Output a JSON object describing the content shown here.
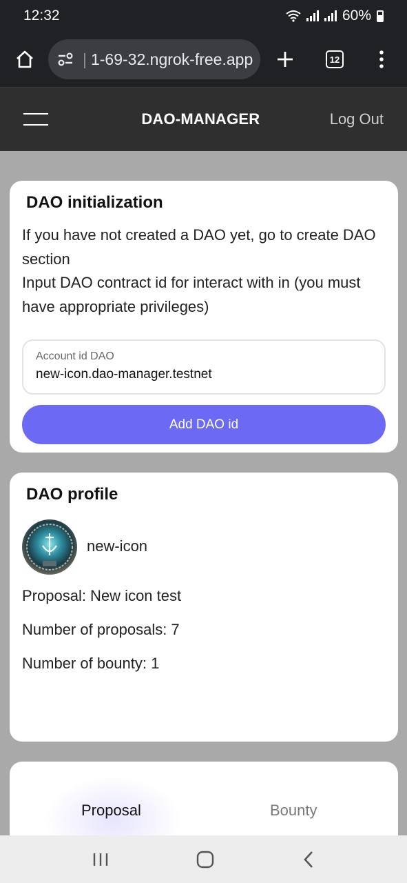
{
  "status_bar": {
    "time": "12:32",
    "battery": "60%"
  },
  "browser": {
    "url": "1-69-32.ngrok-free.app",
    "tabs_count": "12"
  },
  "header": {
    "title": "DAO-MANAGER",
    "logout_label": "Log Out"
  },
  "init_card": {
    "title": "DAO initialization",
    "text_line1": "If you have not created a DAO yet, go to create DAO section",
    "text_line2": "Input DAO contract id for interact with in (you must have appropriate privileges)",
    "input_label": "Account id DAO",
    "input_value": "new-icon.dao-manager.testnet",
    "button_label": "Add DAO id"
  },
  "profile_card": {
    "title": "DAO profile",
    "name": "new-icon",
    "proposal": "Proposal: New icon test",
    "proposals_count": "Number of proposals: 7",
    "bounty_count": "Number of bounty: 1"
  },
  "tabs": {
    "proposal": "Proposal",
    "bounty": "Bounty"
  },
  "colors": {
    "accent": "#6c69f5",
    "header_bg": "#2f2f2f",
    "page_bg": "#a9a9a9"
  }
}
